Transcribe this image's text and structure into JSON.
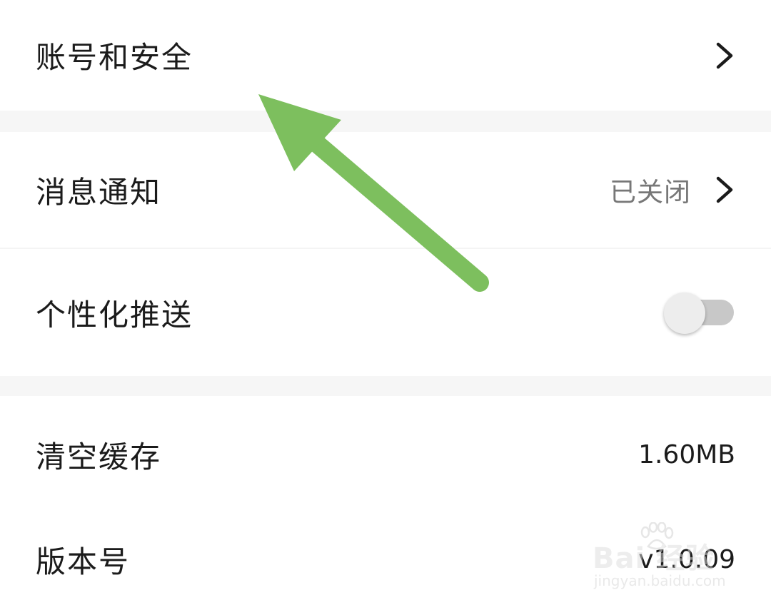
{
  "settings": {
    "account_security": {
      "label": "账号和安全"
    },
    "notifications": {
      "label": "消息通知",
      "value": "已关闭"
    },
    "personalized_push": {
      "label": "个性化推送",
      "toggle_state": "off"
    },
    "clear_cache": {
      "label": "清空缓存",
      "value": "1.60MB"
    },
    "version": {
      "label": "版本号",
      "value": "v1.0.09"
    }
  },
  "overlay": {
    "arrow_color": "#7dbf5e",
    "arrow_target": "account_security"
  },
  "watermark": {
    "logo": "Bai 经验",
    "sub": "jingyan.baidu.com"
  },
  "icons": {
    "chevron": "chevron-right-icon",
    "paw": "baidu-paw-icon"
  },
  "colors": {
    "label": "#1b1b1b",
    "value_muted": "#777777",
    "section_gap": "#f6f6f6",
    "toggle_track_off": "#c8c8c8",
    "toggle_knob": "#ededed"
  }
}
